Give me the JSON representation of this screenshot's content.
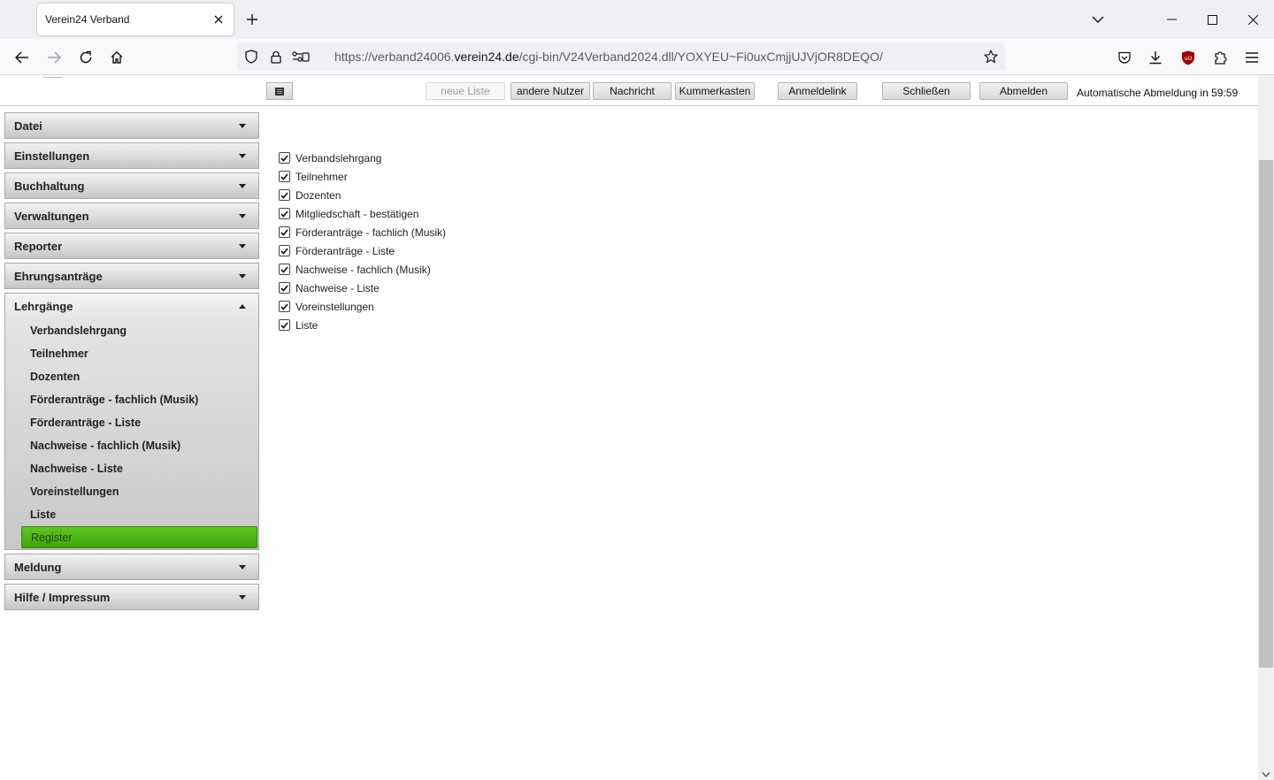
{
  "browser": {
    "tab_title": "Verein24 Verband",
    "url_prefix": "https://verband24006.",
    "url_domain": "verein24.de",
    "url_path": "/cgi-bin/V24Verband2024.dll/YOXYEU~Fi0uxCmjjUJVjOR8DEQO/"
  },
  "toolbar": {
    "neue_liste": "neue Liste",
    "andere_nutzer": "andere Nutzer",
    "nachricht": "Nachricht",
    "kummerkasten": "Kummerkasten",
    "anmeldelink": "Anmeldelink",
    "schliessen": "Schließen",
    "abmelden": "Abmelden",
    "auto_logout": "Automatische Abmeldung in 59:59"
  },
  "sidebar": {
    "sections_top": [
      "Datei",
      "Einstellungen",
      "Buchhaltung",
      "Verwaltungen",
      "Reporter",
      "Ehrungsanträge"
    ],
    "open_section": {
      "label": "Lehrgänge",
      "items": [
        "Verbandslehrgang",
        "Teilnehmer",
        "Dozenten",
        "Förderanträge - fachlich (Musik)",
        "Förderanträge - Liste",
        "Nachweise - fachlich (Musik)",
        "Nachweise - Liste",
        "Voreinstellungen",
        "Liste"
      ],
      "active_item": "Register"
    },
    "sections_bottom": [
      "Meldung",
      "Hilfe / Impressum"
    ]
  },
  "checklist": {
    "items": [
      {
        "label": "Verbandslehrgang",
        "checked": true
      },
      {
        "label": "Teilnehmer",
        "checked": true
      },
      {
        "label": "Dozenten",
        "checked": true
      },
      {
        "label": "Mitgliedschaft - bestätigen",
        "checked": true
      },
      {
        "label": "Förderanträge - fachlich (Musik)",
        "checked": true
      },
      {
        "label": "Förderanträge - Liste",
        "checked": true
      },
      {
        "label": "Nachweise - fachlich (Musik)",
        "checked": true
      },
      {
        "label": "Nachweise - Liste",
        "checked": true
      },
      {
        "label": "Voreinstellungen",
        "checked": true
      },
      {
        "label": "Liste",
        "checked": true
      }
    ]
  },
  "colors": {
    "active_green": "#4cb317",
    "ublock_red": "#a30000"
  }
}
